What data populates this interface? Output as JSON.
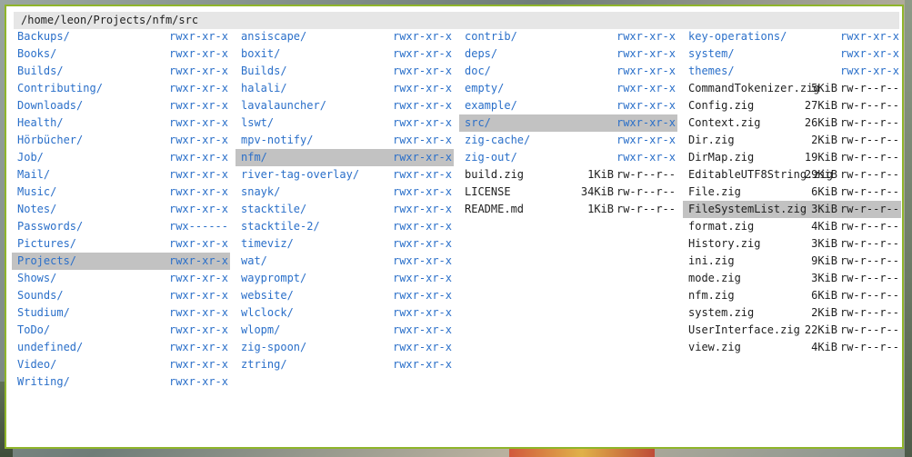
{
  "window": {
    "path": "/home/leon/Projects/nfm/src"
  },
  "columns": [
    {
      "rows": [
        {
          "name": "Backups/",
          "perm": "rwxr-xr-x",
          "dir": true
        },
        {
          "name": "Books/",
          "perm": "rwxr-xr-x",
          "dir": true
        },
        {
          "name": "Builds/",
          "perm": "rwxr-xr-x",
          "dir": true
        },
        {
          "name": "Contributing/",
          "perm": "rwxr-xr-x",
          "dir": true
        },
        {
          "name": "Downloads/",
          "perm": "rwxr-xr-x",
          "dir": true
        },
        {
          "name": "Health/",
          "perm": "rwxr-xr-x",
          "dir": true
        },
        {
          "name": "Hörbücher/",
          "perm": "rwxr-xr-x",
          "dir": true
        },
        {
          "name": "Job/",
          "perm": "rwxr-xr-x",
          "dir": true
        },
        {
          "name": "Mail/",
          "perm": "rwxr-xr-x",
          "dir": true
        },
        {
          "name": "Music/",
          "perm": "rwxr-xr-x",
          "dir": true
        },
        {
          "name": "Notes/",
          "perm": "rwxr-xr-x",
          "dir": true
        },
        {
          "name": "Passwords/",
          "perm": "rwx------",
          "dir": true
        },
        {
          "name": "Pictures/",
          "perm": "rwxr-xr-x",
          "dir": true
        },
        {
          "name": "Projects/",
          "perm": "rwxr-xr-x",
          "dir": true,
          "selected": true
        },
        {
          "name": "Shows/",
          "perm": "rwxr-xr-x",
          "dir": true
        },
        {
          "name": "Sounds/",
          "perm": "rwxr-xr-x",
          "dir": true
        },
        {
          "name": "Studium/",
          "perm": "rwxr-xr-x",
          "dir": true
        },
        {
          "name": "ToDo/",
          "perm": "rwxr-xr-x",
          "dir": true
        },
        {
          "name": "undefined/",
          "perm": "rwxr-xr-x",
          "dir": true
        },
        {
          "name": "Video/",
          "perm": "rwxr-xr-x",
          "dir": true
        },
        {
          "name": "Writing/",
          "perm": "rwxr-xr-x",
          "dir": true
        }
      ]
    },
    {
      "rows": [
        {
          "name": "ansiscape/",
          "perm": "rwxr-xr-x",
          "dir": true
        },
        {
          "name": "boxit/",
          "perm": "rwxr-xr-x",
          "dir": true
        },
        {
          "name": "Builds/",
          "perm": "rwxr-xr-x",
          "dir": true
        },
        {
          "name": "halali/",
          "perm": "rwxr-xr-x",
          "dir": true
        },
        {
          "name": "lavalauncher/",
          "perm": "rwxr-xr-x",
          "dir": true
        },
        {
          "name": "lswt/",
          "perm": "rwxr-xr-x",
          "dir": true
        },
        {
          "name": "mpv-notify/",
          "perm": "rwxr-xr-x",
          "dir": true
        },
        {
          "name": "nfm/",
          "perm": "rwxr-xr-x",
          "dir": true,
          "selected": true
        },
        {
          "name": "river-tag-overlay/",
          "perm": "rwxr-xr-x",
          "dir": true
        },
        {
          "name": "snayk/",
          "perm": "rwxr-xr-x",
          "dir": true
        },
        {
          "name": "stacktile/",
          "perm": "rwxr-xr-x",
          "dir": true
        },
        {
          "name": "stacktile-2/",
          "perm": "rwxr-xr-x",
          "dir": true
        },
        {
          "name": "timeviz/",
          "perm": "rwxr-xr-x",
          "dir": true
        },
        {
          "name": "wat/",
          "perm": "rwxr-xr-x",
          "dir": true
        },
        {
          "name": "wayprompt/",
          "perm": "rwxr-xr-x",
          "dir": true
        },
        {
          "name": "website/",
          "perm": "rwxr-xr-x",
          "dir": true
        },
        {
          "name": "wlclock/",
          "perm": "rwxr-xr-x",
          "dir": true
        },
        {
          "name": "wlopm/",
          "perm": "rwxr-xr-x",
          "dir": true
        },
        {
          "name": "zig-spoon/",
          "perm": "rwxr-xr-x",
          "dir": true
        },
        {
          "name": "ztring/",
          "perm": "rwxr-xr-x",
          "dir": true
        }
      ]
    },
    {
      "rows": [
        {
          "name": "contrib/",
          "perm": "rwxr-xr-x",
          "dir": true
        },
        {
          "name": "deps/",
          "perm": "rwxr-xr-x",
          "dir": true
        },
        {
          "name": "doc/",
          "perm": "rwxr-xr-x",
          "dir": true
        },
        {
          "name": "empty/",
          "perm": "rwxr-xr-x",
          "dir": true
        },
        {
          "name": "example/",
          "perm": "rwxr-xr-x",
          "dir": true
        },
        {
          "name": "src/",
          "perm": "rwxr-xr-x",
          "dir": true,
          "selected": true
        },
        {
          "name": "zig-cache/",
          "perm": "rwxr-xr-x",
          "dir": true
        },
        {
          "name": "zig-out/",
          "perm": "rwxr-xr-x",
          "dir": true
        },
        {
          "name": "build.zig",
          "size": "1KiB",
          "perm": "rw-r--r--"
        },
        {
          "name": "LICENSE",
          "size": "34KiB",
          "perm": "rw-r--r--"
        },
        {
          "name": "README.md",
          "size": "1KiB",
          "perm": "rw-r--r--"
        }
      ]
    },
    {
      "rows": [
        {
          "name": "key-operations/",
          "perm": "rwxr-xr-x",
          "dir": true
        },
        {
          "name": "system/",
          "perm": "rwxr-xr-x",
          "dir": true
        },
        {
          "name": "themes/",
          "perm": "rwxr-xr-x",
          "dir": true
        },
        {
          "name": "CommandTokenizer.zig",
          "size": "5KiB",
          "perm": "rw-r--r--"
        },
        {
          "name": "Config.zig",
          "size": "27KiB",
          "perm": "rw-r--r--"
        },
        {
          "name": "Context.zig",
          "size": "26KiB",
          "perm": "rw-r--r--"
        },
        {
          "name": "Dir.zig",
          "size": "2KiB",
          "perm": "rw-r--r--"
        },
        {
          "name": "DirMap.zig",
          "size": "19KiB",
          "perm": "rw-r--r--"
        },
        {
          "name": "EditableUTF8String.zig",
          "size": "29KiB",
          "perm": "rw-r--r--"
        },
        {
          "name": "File.zig",
          "size": "6KiB",
          "perm": "rw-r--r--"
        },
        {
          "name": "FileSystemList.zig",
          "size": "3KiB",
          "perm": "rw-r--r--",
          "selected": true
        },
        {
          "name": "format.zig",
          "size": "4KiB",
          "perm": "rw-r--r--"
        },
        {
          "name": "History.zig",
          "size": "3KiB",
          "perm": "rw-r--r--"
        },
        {
          "name": "ini.zig",
          "size": "9KiB",
          "perm": "rw-r--r--"
        },
        {
          "name": "mode.zig",
          "size": "3KiB",
          "perm": "rw-r--r--"
        },
        {
          "name": "nfm.zig",
          "size": "6KiB",
          "perm": "rw-r--r--"
        },
        {
          "name": "system.zig",
          "size": "2KiB",
          "perm": "rw-r--r--"
        },
        {
          "name": "UserInterface.zig",
          "size": "22KiB",
          "perm": "rw-r--r--"
        },
        {
          "name": "view.zig",
          "size": "4KiB",
          "perm": "rw-r--r--"
        }
      ]
    }
  ]
}
